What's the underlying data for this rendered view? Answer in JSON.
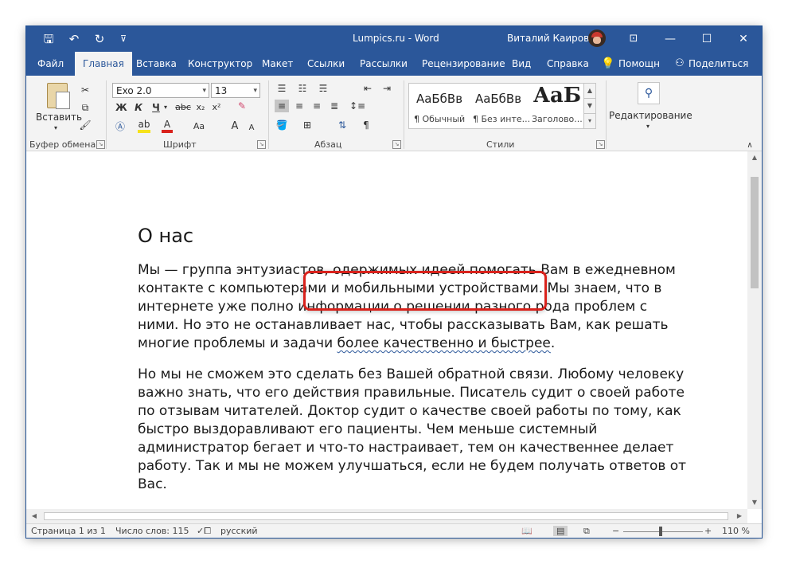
{
  "window": {
    "title": "Lumpics.ru  -  Word",
    "user_name": "Виталий Каиров",
    "minimize_glyph": "—",
    "maximize_glyph": "☐",
    "close_glyph": "✕",
    "restore_glyph": "⊡"
  },
  "quick_access": {
    "save_glyph": "🖫",
    "undo_glyph": "↶",
    "redo_glyph": "↻",
    "customize_glyph": "⊽"
  },
  "tabs": [
    {
      "label": "Файл"
    },
    {
      "label": "Главная"
    },
    {
      "label": "Вставка"
    },
    {
      "label": "Конструктор"
    },
    {
      "label": "Макет"
    },
    {
      "label": "Ссылки"
    },
    {
      "label": "Рассылки"
    },
    {
      "label": "Рецензирование"
    },
    {
      "label": "Вид"
    },
    {
      "label": "Справка"
    },
    {
      "label": "Помощн"
    },
    {
      "label": "Поделиться"
    }
  ],
  "ribbon": {
    "clipboard": {
      "label": "Буфер обмена",
      "paste_label": "Вставить"
    },
    "font": {
      "label": "Шрифт",
      "font_name": "Exo 2.0",
      "font_size": "13",
      "bold": "Ж",
      "italic": "К",
      "underline": "Ч",
      "strike": "abc",
      "sub": "x₂",
      "sup": "x²",
      "case": "Aa",
      "grow": "A",
      "shrink": "A"
    },
    "paragraph": {
      "label": "Абзац",
      "pilcrow": "¶"
    },
    "styles": {
      "label": "Стили",
      "items": [
        {
          "preview": "АаБбВв",
          "name": "¶ Обычный"
        },
        {
          "preview": "АаБбВв",
          "name": "¶ Без инте..."
        },
        {
          "preview": "АаБ",
          "name": "Заголово..."
        }
      ]
    },
    "editing": {
      "label": "Редактирование"
    }
  },
  "document": {
    "heading": "О нас",
    "para1_lines": [
      "Мы — группа энтузиастов, одержимых идеей помогать Вам в ежедневном",
      "контакте с компьютерами и мобильными устройствами. Мы знаем, что в",
      "интернете уже полно информации о решении разного рода проблем с",
      "ними. Но это не останавливает нас, чтобы рассказывать Вам, как решать"
    ],
    "para1_last_before": "многие проблемы и задачи ",
    "para1_last_marked": "более качественно и быстрее",
    "para1_last_after": ".",
    "para2_lines": [
      "Но мы не сможем это сделать без Вашей обратной связи. Любому человеку",
      "важно знать, что его действия правильные. Писатель судит о своей работе",
      "по отзывам читателей. Доктор судит о качестве своей работы по тому, как",
      "быстро выздоравливают его пациенты. Чем меньше системный",
      "администратор бегает и что-то настраивает, тем он качественнее делает",
      "работу. Так и мы не можем улучшаться, если не будем получать ответов от",
      "Вас."
    ]
  },
  "status": {
    "page": "Страница 1 из 1",
    "words": "Число слов: 115",
    "language": "русский",
    "zoom": "110 %",
    "zoom_minus": "−",
    "zoom_plus": "+",
    "zoom_level": 0.47
  }
}
